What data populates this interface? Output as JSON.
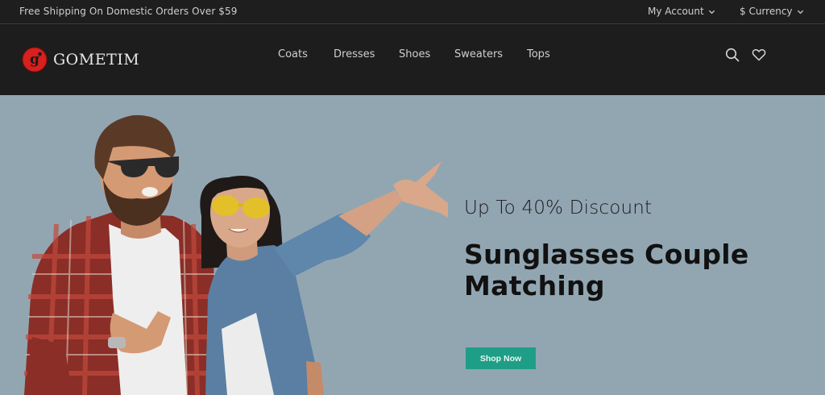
{
  "topbar": {
    "promo": "Free Shipping On Domestic Orders Over $59",
    "account_label": "My Account",
    "currency_label": "$ Currency"
  },
  "header": {
    "logo_text": "GOMETIM",
    "logo_mark_letter": "g",
    "nav": [
      {
        "label": "Coats"
      },
      {
        "label": "Dresses"
      },
      {
        "label": "Shoes"
      },
      {
        "label": "Sweaters"
      },
      {
        "label": "Tops"
      }
    ],
    "icons": [
      "search-icon",
      "heart-icon"
    ]
  },
  "hero": {
    "subtitle": "Up To 40% Discount",
    "title": "Sunglasses Couple Matching",
    "cta_label": "Shop Now"
  },
  "colors": {
    "hero_bg": "#92a6b2",
    "cta_bg": "#1e9e86",
    "logo_red": "#d8201e",
    "header_bg": "#1d1d1d"
  }
}
